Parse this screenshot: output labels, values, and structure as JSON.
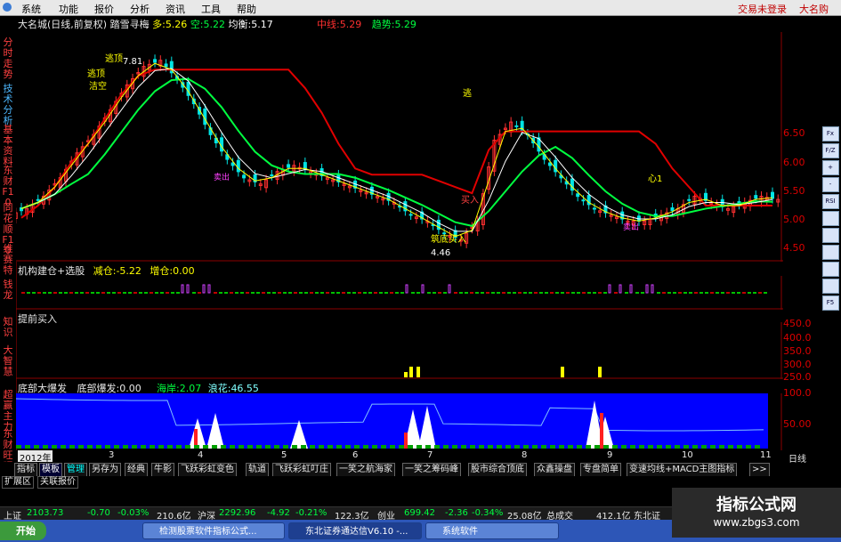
{
  "menubar": {
    "items": [
      "系统",
      "功能",
      "报价",
      "分析",
      "资讯",
      "工具",
      "帮助"
    ],
    "status_text": "交易未登录",
    "brand_text": "大名购"
  },
  "left_tabs": [
    {
      "label": "分时走势",
      "color": "red"
    },
    {
      "label": "技术分析",
      "color": "blue"
    },
    {
      "label": "基本资料",
      "color": "red"
    },
    {
      "label": "东财F10",
      "color": "red"
    },
    {
      "label": "同花顺F10",
      "color": "red"
    },
    {
      "label": "维赛特",
      "color": "red"
    },
    {
      "label": "钱龙",
      "color": "red"
    },
    {
      "label": "知识",
      "color": "red"
    },
    {
      "label": "大智慧",
      "color": "red"
    },
    {
      "label": "超赢主力",
      "color": "red"
    },
    {
      "label": "东财旺吧",
      "color": "red"
    }
  ],
  "main_panel": {
    "title": "大名城(日线,前复权)",
    "indicator_name": "踏雪寻梅",
    "duo_label": "多:",
    "duo_value": "5.26",
    "kong_label": "空:",
    "kong_value": "5.22",
    "junheng_label": "均衡:",
    "junheng_value": "5.17",
    "zhongxian_label": "中线:",
    "zhongxian_value": "5.29",
    "qushi_label": "趋势:",
    "qushi_value": "5.29",
    "annotations": [
      "逃顶",
      "逃顶",
      "洁空",
      "逃",
      "买入",
      "筑底买入",
      "卖出",
      "卖出",
      "心1"
    ],
    "high_label": "7.81",
    "low_label": "4.46",
    "axis_ticks": [
      "6.50",
      "6.00",
      "5.50",
      "5.00",
      "4.50"
    ]
  },
  "panel2": {
    "title": "机构建仓+选股",
    "jiancang_label": "减仓:",
    "jiancang_value": "-5.22",
    "zengcang_label": "增仓:",
    "zengcang_value": "0.00"
  },
  "panel3": {
    "title": "提前买入",
    "axis_ticks": [
      "450.0",
      "400.0",
      "350.0",
      "300.0",
      "250.0"
    ]
  },
  "panel4": {
    "title": "底部大爆发",
    "bottom_label": "底部爆发:",
    "bottom_value": "0.00",
    "haian_label": "海岸:",
    "haian_value": "2.07",
    "langhua_label": "浪花:",
    "langhua_value": "46.55",
    "axis_ticks": [
      "100.0",
      "50.00"
    ]
  },
  "time_axis": {
    "labels": [
      "2012年",
      "3",
      "4",
      "5",
      "6",
      "7",
      "8",
      "9",
      "10",
      "11"
    ],
    "period_label": "日线"
  },
  "tabbar": [
    "指标",
    "模板",
    "管理",
    "另存为",
    "经典",
    "牛影",
    "飞跃彩虹变色",
    "轨道",
    "飞跃彩虹叮庄",
    "一笑之航海家",
    "一笑之筹码峰",
    "股市综合顶底",
    "众鑫操盘",
    "专盘简单",
    "变速均线+MACD主图指标",
    ">>"
  ],
  "extbar": [
    "扩展区",
    "关联报价"
  ],
  "right_tools": [
    "Fx",
    "F/Z",
    "+",
    "-",
    "RSI",
    "",
    "",
    "",
    "",
    "",
    "F5"
  ],
  "ticker": [
    {
      "name": "上证",
      "value": "2103.73",
      "change": "-0.70",
      "pct": "-0.03%",
      "amount": "210.6亿"
    },
    {
      "name": "沪深",
      "value": "2292.96",
      "change": "-4.92",
      "pct": "-0.21%",
      "amount": "122.3亿"
    },
    {
      "name": "创业",
      "value": "699.42",
      "change": "-2.36",
      "pct": "-0.34%",
      "amount": "25.08亿"
    },
    {
      "name": "总成交",
      "value": "412.1亿",
      "change": "",
      "pct": "",
      "amount": ""
    },
    {
      "name": "东北证",
      "value": "",
      "change": "",
      "pct": "",
      "amount": ""
    }
  ],
  "taskbar": {
    "start": "开始",
    "tasks": [
      "检测股票软件指标公式...",
      "东北证券通达信V6.10 -...",
      "系统软件"
    ]
  },
  "watermark": {
    "title": "指标公式网",
    "url": "www.zbgs3.com"
  },
  "colors": {
    "up": "#ff3030",
    "down": "#00e5e5",
    "ma_green": "#00ff40",
    "ma_red": "#e00000",
    "ma_white": "#ffffff",
    "panel_blue": "#0000ff",
    "yellow": "#ffff00",
    "magenta": "#d040ff"
  },
  "chart_data": [
    {
      "type": "line",
      "title": "",
      "series": [
        {
          "name": "",
          "values": [
            5.1,
            5.3,
            5.6,
            6.0,
            6.3,
            6.7,
            7.1,
            7.4,
            7.5,
            7.2,
            6.8,
            6.3,
            5.9,
            5.6,
            5.5,
            5.7,
            5.8,
            5.7,
            5.6,
            5.5,
            5.4,
            5.3,
            5.2,
            5.0,
            4.9,
            4.7,
            4.6,
            4.9,
            6.2,
            6.5,
            6.3,
            5.9,
            5.6,
            5.3,
            5.1,
            5.0,
            4.9,
            4.9,
            5.0,
            5.1,
            5.3,
            5.2,
            5.1,
            5.2,
            5.3,
            5.25
          ]
        }
      ],
      "ylim": [
        4.3,
        7.9
      ]
    }
  ]
}
